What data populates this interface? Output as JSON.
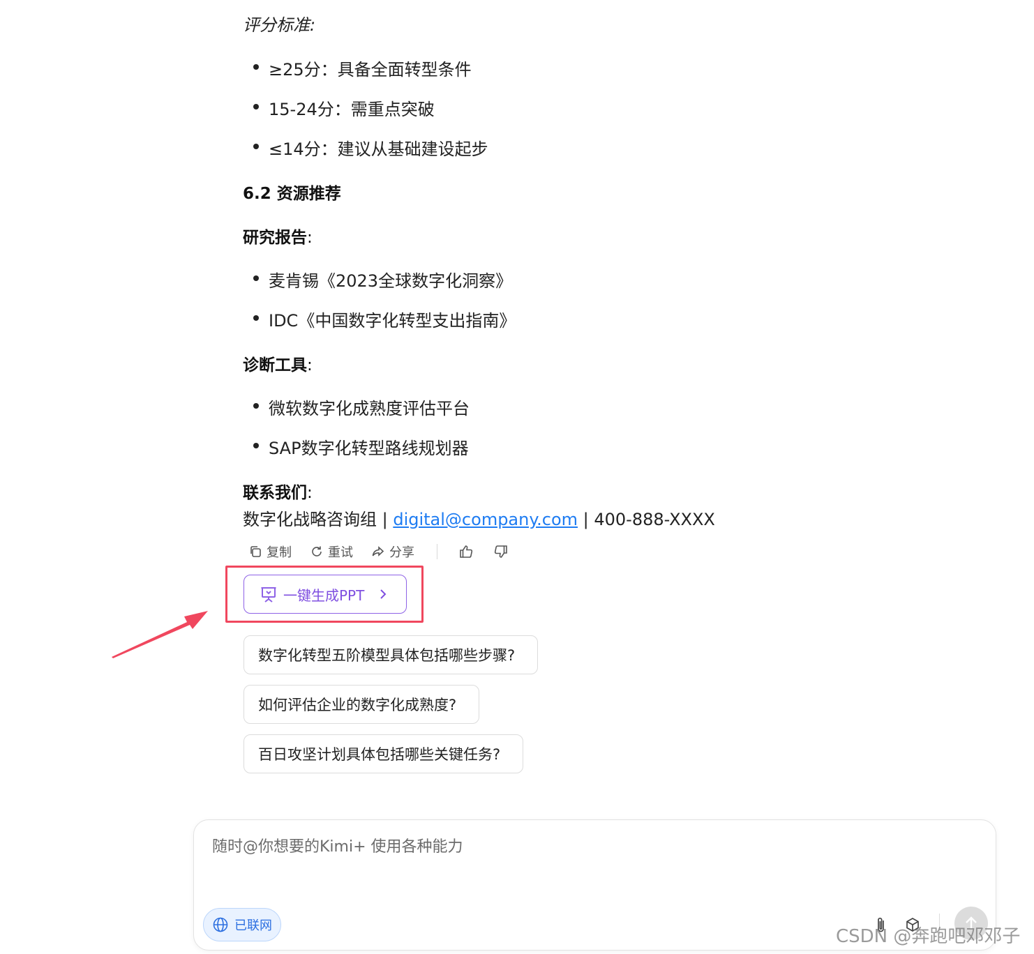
{
  "article": {
    "criteria_title": "评分标准:",
    "criteria": [
      "≥25分：具备全面转型条件",
      "15-24分：需重点突破",
      "≤14分：建议从基础建设起步"
    ],
    "section_title": "6.2 资源推荐",
    "reports_title": "研究报告",
    "reports": [
      "麦肯锡《2023全球数字化洞察》",
      "IDC《中国数字化转型支出指南》"
    ],
    "tools_title": "诊断工具",
    "tools": [
      "微软数字化成熟度评估平台",
      "SAP数字化转型路线规划器"
    ],
    "contact_title": "联系我们",
    "colon": ":",
    "contact_group": "数字化战略咨询组 | ",
    "contact_email": "digital@company.com",
    "contact_phone": " | 400-888-XXXX"
  },
  "actions": {
    "copy": "复制",
    "retry": "重试",
    "share": "分享"
  },
  "ppt_button": "一键生成PPT",
  "suggestions": [
    "数字化转型五阶模型具体包括哪些步骤?",
    "如何评估企业的数字化成熟度?",
    "百日攻坚计划具体包括哪些关键任务?"
  ],
  "input": {
    "placeholder": "随时@你想要的Kimi+ 使用各种能力",
    "network_label": "已联网"
  },
  "watermark": "CSDN @奔跑吧邓邓子",
  "colors": {
    "accent_purple": "#7f4fe0",
    "highlight_red": "#f0475e",
    "link_blue": "#1e7cf2"
  }
}
